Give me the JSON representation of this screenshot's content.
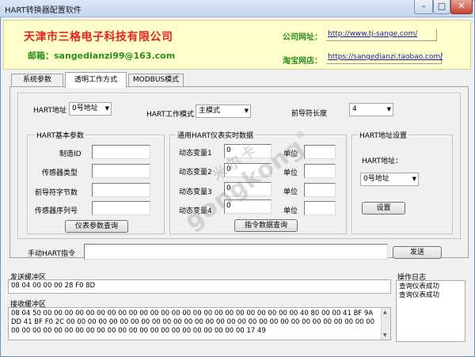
{
  "window": {
    "title": "HART转换器配置软件"
  },
  "banner": {
    "company": "天津市三格电子科技有限公司",
    "email": "邮箱：sangedianzi99@163.com",
    "website_label": "公司网址：",
    "website_url": "http://www.tj-sange.com/",
    "taobao_label": "淘宝网店：",
    "taobao_url": "https://sangedianzi.taobao.com/"
  },
  "tabs": [
    {
      "label": "系统参数"
    },
    {
      "label": "透明工作方式"
    },
    {
      "label": "MODBUS模式"
    }
  ],
  "top_row": {
    "hart_address_label": "HART地址",
    "hart_address_value": "0号地址",
    "work_mode_label": "HART工作模式",
    "work_mode_value": "主模式",
    "preamble_label": "前导符长度",
    "preamble_value": "4"
  },
  "basic_params": {
    "title": "HART基本参数",
    "manufacturer_id_label": "制造ID",
    "sensor_type_label": "传感器类型",
    "preamble_bytes_label": "前导符字节数",
    "sensor_serial_label": "传感器序列号",
    "query_button": "仪表参数查询"
  },
  "realtime": {
    "title": "通用HART仪表实时数据",
    "var1_label": "动态变量1",
    "var2_label": "动态变量2",
    "var3_label": "动态变量3",
    "var4_label": "动态变量4",
    "var1_value": "0",
    "var2_value": "0",
    "var3_value": "0",
    "var4_value": "0",
    "unit_label": "单位",
    "query_button": "指令数据查询"
  },
  "address_settings": {
    "title": "HART地址设置",
    "address_label": "HART地址：",
    "address_value": "0号地址",
    "set_button": "设置"
  },
  "manual": {
    "label": "手动HART指令",
    "value": "",
    "send_button": "发送"
  },
  "send_buffer": {
    "label": "发送缓冲区",
    "content": "08 04 00 00 00 28 F0 8D"
  },
  "receive_buffer": {
    "label": "接收缓冲区",
    "content": "08 04 50 00 00 00 00 00 00 00 00 00 00 00 00 00 00 00 00 00 00 00 00 00 00 00 00 40 80 00 00 41 BF 9A DD 41 BF F0 2C 00 00 00 00 00 00 00 00 00 00 00 00 00 00 00 00 00 00 00 00 00 00 00 00 00 00 00 00 00 00 00 00 00 00 00 00 00 00 00 00 00 00 00 00 00 00 00 00 00 00 00 17 49"
  },
  "log": {
    "label": "操作日志",
    "lines": [
      "查询仪表成功",
      "查询仪表成功"
    ]
  },
  "watermark": {
    "line1": "米尔卡",
    "line2": "gongkong",
    "symbol": "®"
  }
}
